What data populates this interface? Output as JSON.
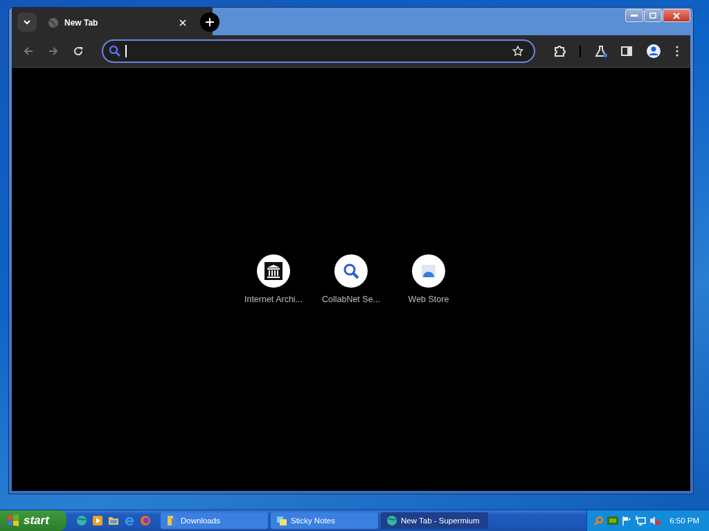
{
  "tabs": [
    {
      "title": "New Tab",
      "selected": true
    }
  ],
  "shortcuts": [
    {
      "label": "Internet Archi...",
      "kind": "building"
    },
    {
      "label": "CollabNet Se...",
      "kind": "magnifier"
    },
    {
      "label": "Web Store",
      "kind": "store"
    }
  ],
  "taskbar": {
    "start": "start",
    "tasks": [
      {
        "label": "Downloads",
        "kind": "folder",
        "selected": false
      },
      {
        "label": "Sticky Notes",
        "kind": "notes",
        "selected": false
      },
      {
        "label": "New Tab - Supermium",
        "kind": "globe",
        "selected": true
      }
    ],
    "clock": "6:50 PM"
  }
}
